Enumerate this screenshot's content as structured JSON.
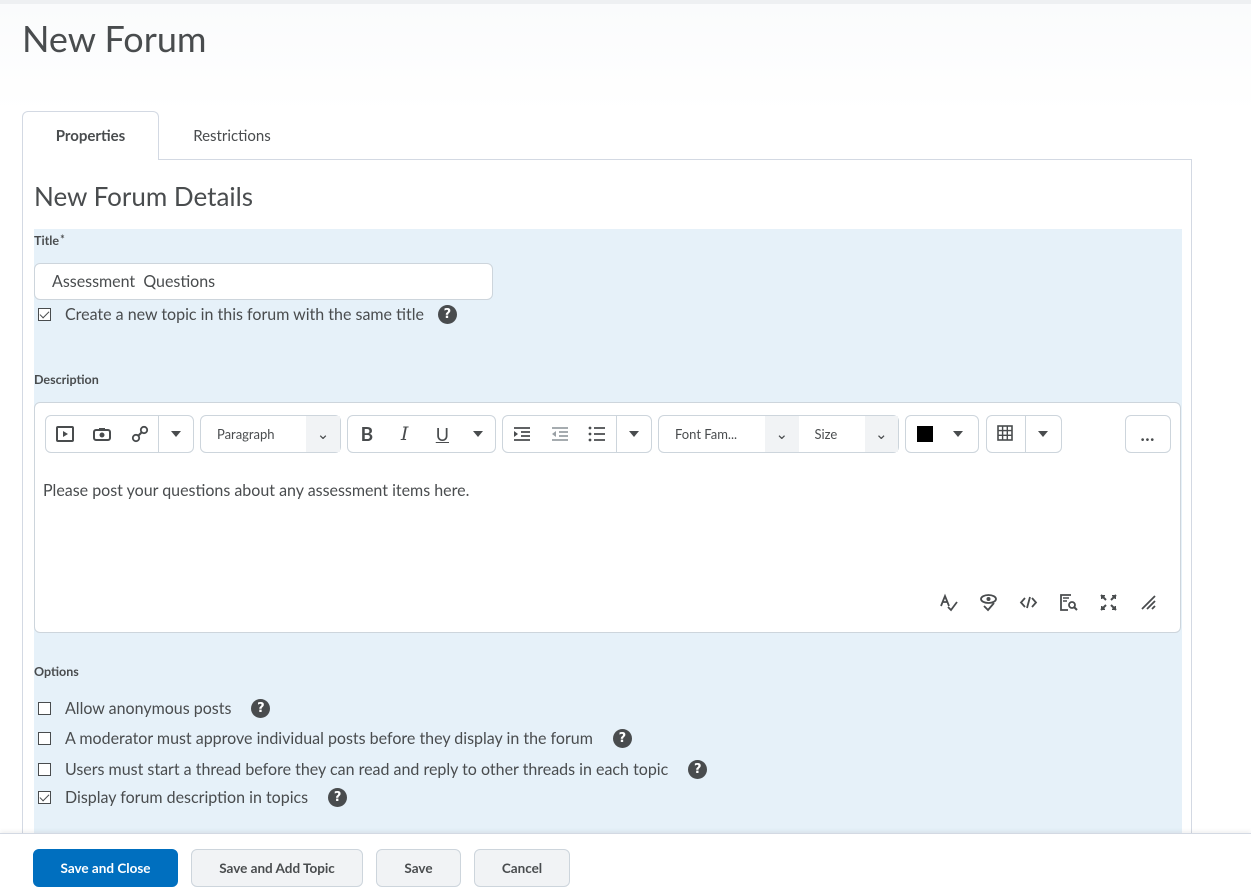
{
  "page": {
    "title": "New Forum"
  },
  "tabs": [
    {
      "label": "Properties",
      "active": true
    },
    {
      "label": "Restrictions",
      "active": false
    }
  ],
  "details": {
    "heading": "New Forum Details",
    "title_label": "Title",
    "required_marker": "*",
    "title_value": "Assessment  Questions",
    "create_topic_label": "Create a new topic in this forum with the same title",
    "create_topic_checked": true
  },
  "description": {
    "label": "Description",
    "toolbar": {
      "paragraph": "Paragraph",
      "bold": "B",
      "italic": "I",
      "underline": "U",
      "font_family": "Font Fam...",
      "size": "Size",
      "more": "…",
      "color": "#000000"
    },
    "content": "Please post your questions about any assessment items here."
  },
  "options": {
    "label": "Options",
    "items": [
      {
        "label": "Allow anonymous posts",
        "checked": false
      },
      {
        "label": "A moderator must approve individual posts before they display in the forum",
        "checked": false
      },
      {
        "label": "Users must start a thread before they can read and reply to other threads in each topic",
        "checked": false
      },
      {
        "label": "Display forum description in topics",
        "checked": true
      }
    ]
  },
  "footer": {
    "save_close": "Save and Close",
    "save_add_topic": "Save and Add Topic",
    "save": "Save",
    "cancel": "Cancel"
  },
  "colors": {
    "primary": "#006fbf",
    "shaded": "#e6f1f9",
    "text": "#494c4e"
  }
}
